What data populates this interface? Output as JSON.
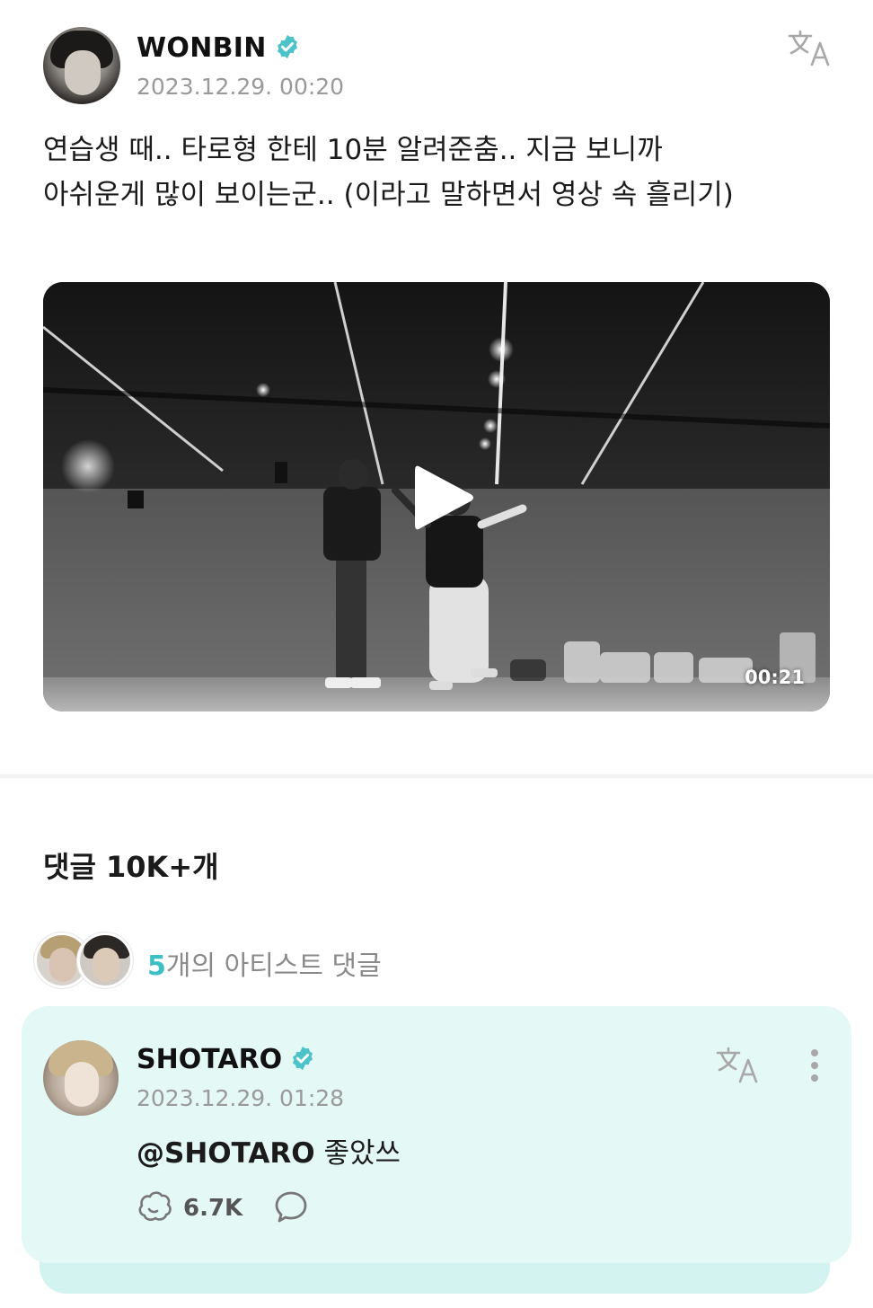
{
  "post": {
    "author": "WONBIN",
    "date": "2023.12.29. 00:20",
    "text_line1": "연습생 때.. 타로형 한테 10분 알려준춤.. 지금 보니까",
    "text_line2": "아쉬운게 많이 보이는군.. (이라고 말하면서 영상 속 흘리기)",
    "video": {
      "duration": "00:21",
      "play_icon": "play-icon"
    },
    "icons": {
      "verified": "verified-badge-icon",
      "translate": "translate-icon"
    }
  },
  "comments": {
    "title": "댓글 10K+개",
    "artist_summary": {
      "count": "5",
      "label": "개의 아티스트 댓글"
    },
    "items": [
      {
        "author": "SHOTARO",
        "date": "2023.12.29. 01:28",
        "mention": "@SHOTARO",
        "text": " 좋았쓰",
        "likes": "6.7K",
        "icons": [
          "translate-icon",
          "more-icon",
          "like-icon",
          "reply-icon"
        ]
      }
    ]
  },
  "colors": {
    "accent": "#3dbfc6",
    "verified": "#4cc3c9",
    "card_bg": "#e4f8f6",
    "muted_text": "#9a9a9a"
  }
}
